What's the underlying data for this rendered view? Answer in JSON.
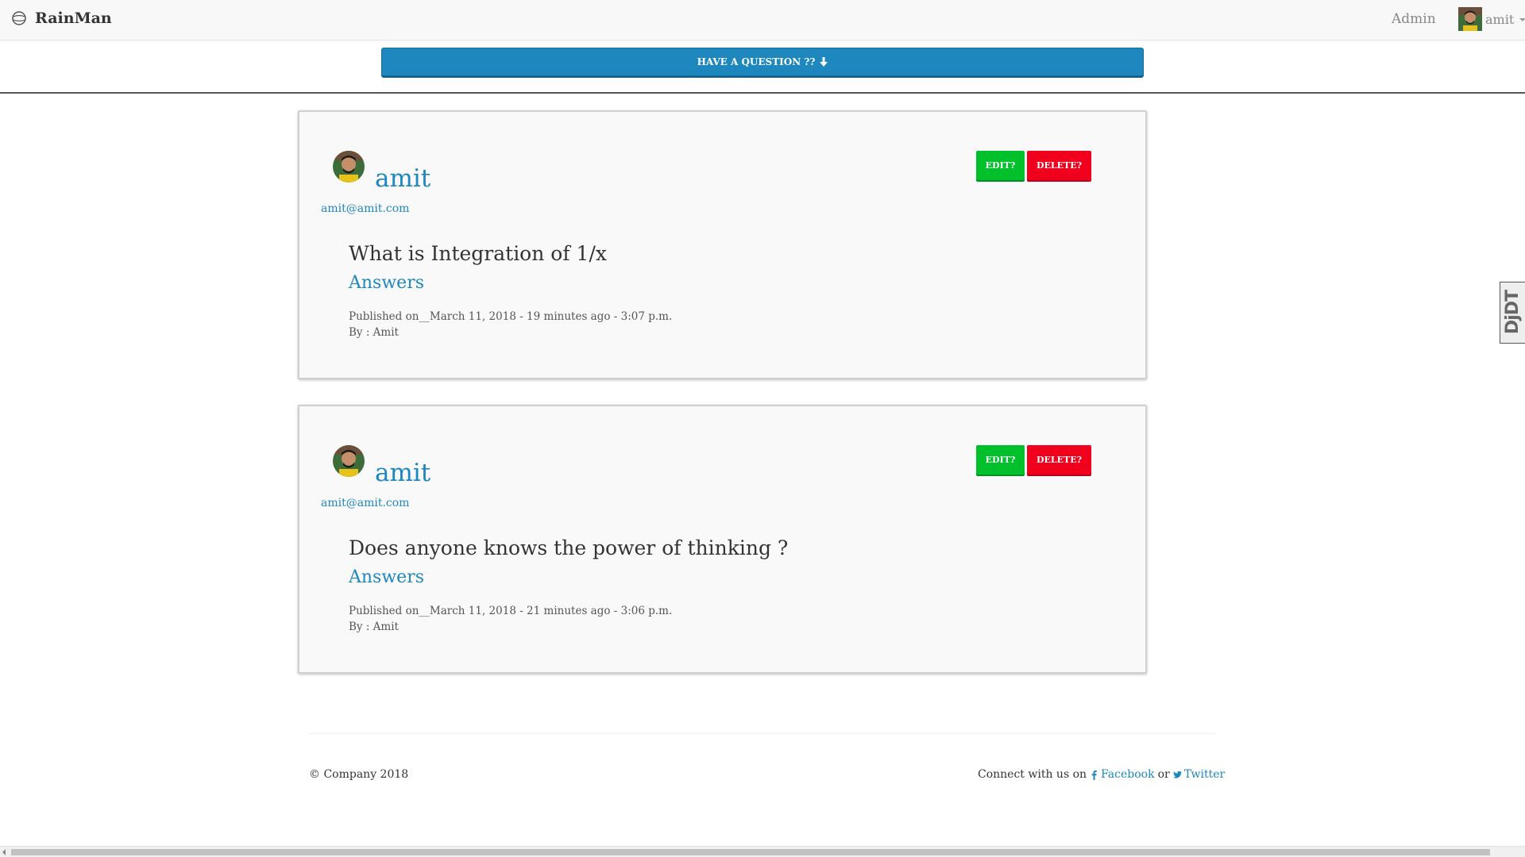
{
  "navbar": {
    "brand": "RainMan",
    "admin_link": "Admin",
    "user_name": "amit"
  },
  "ask_button": {
    "label": "HAVE A QUESTION ??"
  },
  "questions": [
    {
      "author": "amit",
      "email": "amit@amit.com",
      "edit_label": "EDIT?",
      "delete_label": "DELETE?",
      "title": "What is Integration of 1/x",
      "answers_label": "Answers",
      "published": "Published on__March 11, 2018 - 19 minutes ago - 3:07 p.m.",
      "by": "By : Amit"
    },
    {
      "author": "amit",
      "email": "amit@amit.com",
      "edit_label": "EDIT?",
      "delete_label": "DELETE?",
      "title": "Does anyone knows the power of thinking ?",
      "answers_label": "Answers",
      "published": "Published on__March 11, 2018 - 21 minutes ago - 3:06 p.m.",
      "by": "By : Amit"
    }
  ],
  "footer": {
    "copyright": "© Company 2018",
    "connect_text": "Connect with us on",
    "facebook": "Facebook",
    "or_text": "or",
    "twitter": "Twitter"
  },
  "debug_toolbar": {
    "label": "DjDT"
  },
  "colors": {
    "link_blue": "#1e87bd",
    "edit_green": "#00c12b",
    "delete_red": "#f0001d"
  }
}
